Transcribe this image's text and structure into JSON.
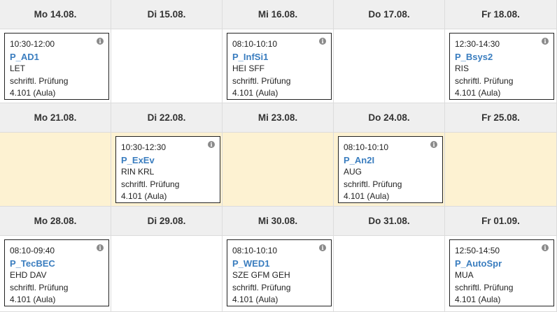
{
  "weeks": [
    {
      "days": [
        {
          "label": "Mo 14.08.",
          "event": {
            "time": "10:30-12:00",
            "code": "P_AD1",
            "staff": "LET",
            "type": "schriftl. Prüfung",
            "room": "4.101 (Aula)"
          }
        },
        {
          "label": "Di 15.08."
        },
        {
          "label": "Mi 16.08.",
          "event": {
            "time": "08:10-10:10",
            "code": "P_InfSi1",
            "staff": "HEI SFF",
            "type": "schriftl. Prüfung",
            "room": "4.101 (Aula)"
          }
        },
        {
          "label": "Do 17.08."
        },
        {
          "label": "Fr 18.08.",
          "event": {
            "time": "12:30-14:30",
            "code": "P_Bsys2",
            "staff": "RIS",
            "type": "schriftl. Prüfung",
            "room": "4.101 (Aula)"
          }
        }
      ]
    },
    {
      "highlight": true,
      "days": [
        {
          "label": "Mo 21.08."
        },
        {
          "label": "Di 22.08.",
          "event": {
            "time": "10:30-12:30",
            "code": "P_ExEv",
            "staff": "RIN KRL",
            "type": "schriftl. Prüfung",
            "room": "4.101 (Aula)"
          }
        },
        {
          "label": "Mi 23.08."
        },
        {
          "label": "Do 24.08.",
          "event": {
            "time": "08:10-10:10",
            "code": "P_An2I",
            "staff": "AUG",
            "type": "schriftl. Prüfung",
            "room": "4.101 (Aula)"
          }
        },
        {
          "label": "Fr 25.08."
        }
      ]
    },
    {
      "days": [
        {
          "label": "Mo 28.08.",
          "event": {
            "time": "08:10-09:40",
            "code": "P_TecBEC",
            "staff": "EHD DAV",
            "type": "schriftl. Prüfung",
            "room": "4.101 (Aula)"
          }
        },
        {
          "label": "Di 29.08."
        },
        {
          "label": "Mi 30.08.",
          "event": {
            "time": "08:10-10:10",
            "code": "P_WED1",
            "staff": "SZE GFM GEH",
            "type": "schriftl. Prüfung",
            "room": "4.101 (Aula)"
          }
        },
        {
          "label": "Do 31.08."
        },
        {
          "label": "Fr 01.09.",
          "event": {
            "time": "12:50-14:50",
            "code": "P_AutoSpr",
            "staff": "MUA",
            "type": "schriftl. Prüfung",
            "room": "4.101 (Aula)"
          }
        }
      ]
    }
  ],
  "info_icon": {
    "glyph": "i",
    "name": "info-icon"
  }
}
